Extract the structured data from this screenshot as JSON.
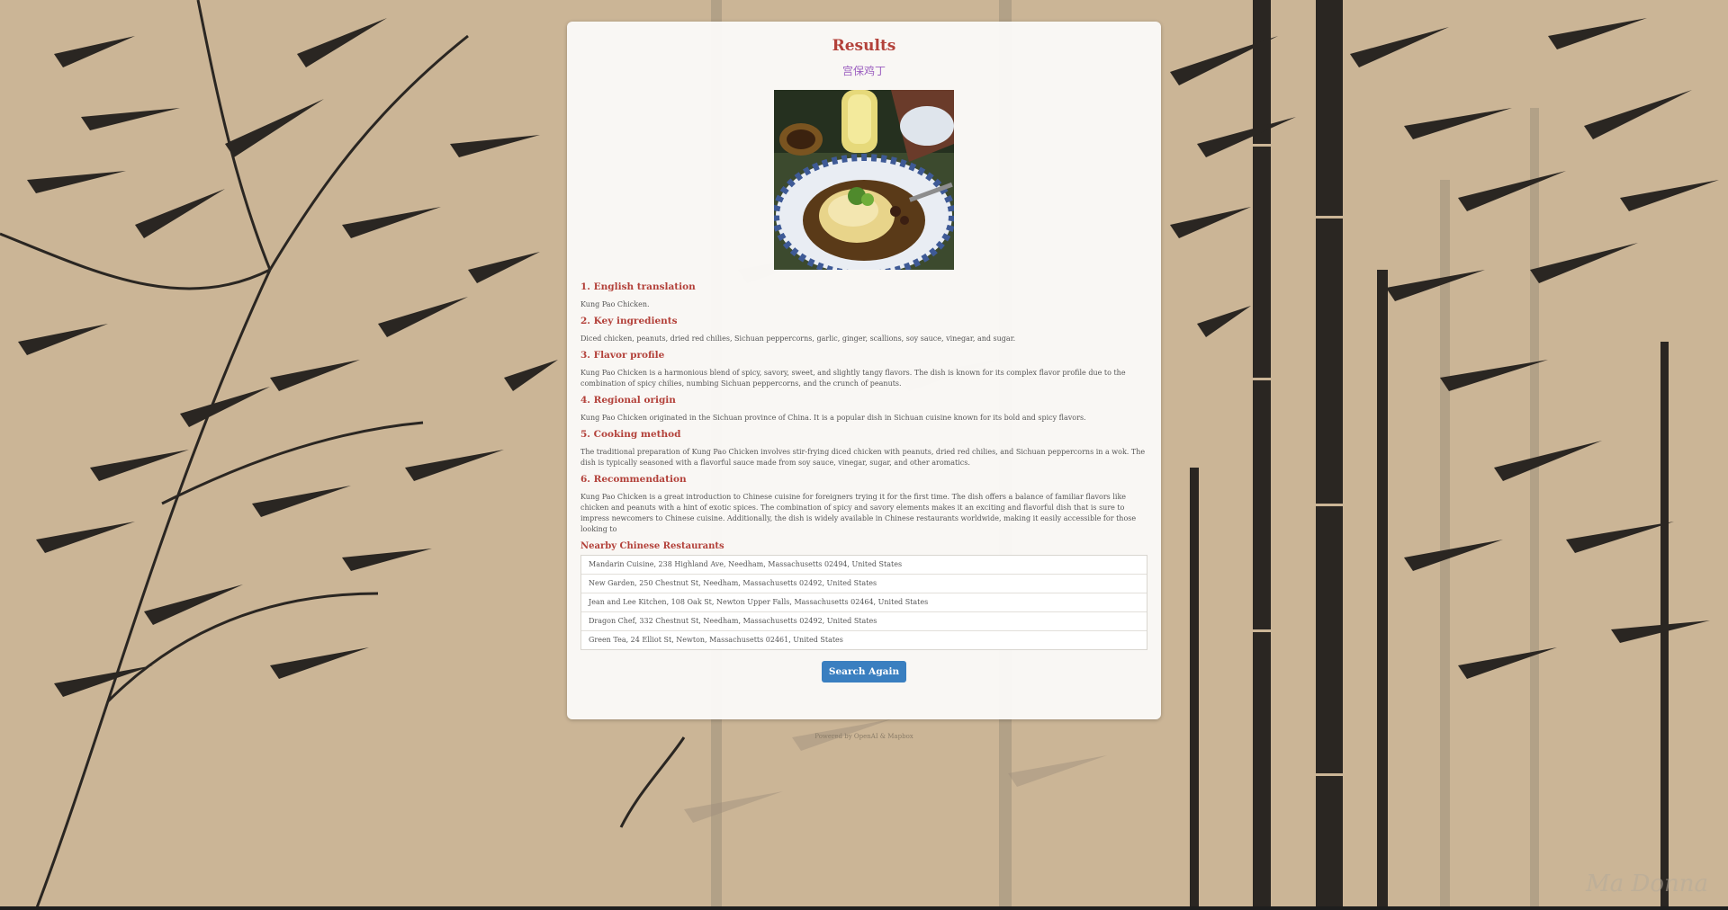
{
  "page": {
    "title": "Results",
    "chinese_name": "宫保鸡丁",
    "photo_alt": "Kung Pao Chicken"
  },
  "sections": [
    {
      "heading": "1. English translation",
      "text": "Kung Pao Chicken."
    },
    {
      "heading": "2. Key ingredients",
      "text": "Diced chicken, peanuts, dried red chilies, Sichuan peppercorns, garlic, ginger, scallions, soy sauce, vinegar, and sugar."
    },
    {
      "heading": "3. Flavor profile",
      "text": "Kung Pao Chicken is a harmonious blend of spicy, savory, sweet, and slightly tangy flavors. The dish is known for its complex flavor profile due to the combination of spicy chilies, numbing Sichuan peppercorns, and the crunch of peanuts."
    },
    {
      "heading": "4. Regional origin",
      "text": "Kung Pao Chicken originated in the Sichuan province of China. It is a popular dish in Sichuan cuisine known for its bold and spicy flavors."
    },
    {
      "heading": "5. Cooking method",
      "text": "The traditional preparation of Kung Pao Chicken involves stir-frying diced chicken with peanuts, dried red chilies, and Sichuan peppercorns in a wok. The dish is typically seasoned with a flavorful sauce made from soy sauce, vinegar, sugar, and other aromatics."
    },
    {
      "heading": "6. Recommendation",
      "text": "Kung Pao Chicken is a great introduction to Chinese cuisine for foreigners trying it for the first time. The dish offers a balance of familiar flavors like chicken and peanuts with a hint of exotic spices. The combination of spicy and savory elements makes it an exciting and flavorful dish that is sure to impress newcomers to Chinese cuisine. Additionally, the dish is widely available in Chinese restaurants worldwide, making it easily accessible for those looking to"
    }
  ],
  "restaurants": {
    "heading": "Nearby Chinese Restaurants",
    "items": [
      "Mandarin Cuisine, 238 Highland Ave, Needham, Massachusetts 02494, United States",
      "New Garden, 250 Chestnut St, Needham, Massachusetts 02492, United States",
      "Jean and Lee Kitchen, 108 Oak St, Newton Upper Falls, Massachusetts 02464, United States",
      "Dragon Chef, 332 Chestnut St, Needham, Massachusetts 02492, United States",
      "Green Tea, 24 Elliot St, Newton, Massachusetts 02461, United States"
    ]
  },
  "actions": {
    "search_again_label": "Search Again"
  },
  "footer": {
    "text": "Powered by OpenAI & Mapbox"
  },
  "background": {
    "signature": "Ma Donna",
    "colors": {
      "paper": "#cbb596",
      "ink": "#2a2622"
    }
  },
  "theme": {
    "heading_color": "#b3413a",
    "chinese_color": "#9b5fc0",
    "button_color": "#3a7fc0"
  }
}
